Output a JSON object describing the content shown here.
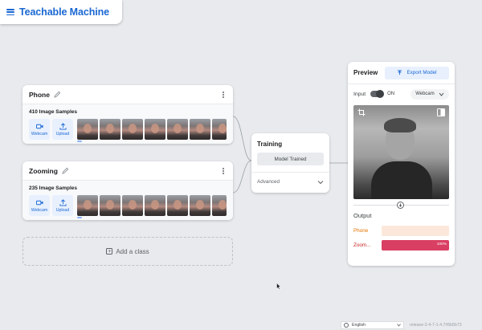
{
  "app": {
    "title": "Teachable Machine"
  },
  "classes": [
    {
      "name": "Phone",
      "samples": "410 Image Samples",
      "webcam_label": "Webcam",
      "upload_label": "Upload"
    },
    {
      "name": "Zooming",
      "samples": "235 Image Samples",
      "webcam_label": "Webcam",
      "upload_label": "Upload"
    }
  ],
  "add_class": {
    "label": "Add a class"
  },
  "training": {
    "title": "Training",
    "button_label": "Model Trained",
    "advanced_label": "Advanced"
  },
  "preview": {
    "title": "Preview",
    "export_label": "Export Model",
    "input_label": "Input",
    "toggle_state": "ON",
    "source_select": "Webcam",
    "output_title": "Output",
    "outputs": [
      {
        "label": "Phone",
        "confidence": 0,
        "percent_text": "",
        "label_color": "#e37400",
        "track_color": "#fce8db",
        "fill_color": "#f29d4b"
      },
      {
        "label": "Zoom...",
        "confidence": 1,
        "percent_text": "100%",
        "label_color": "#c5221f",
        "track_color": "#f8c9d2",
        "fill_color": "#d93f62"
      }
    ]
  },
  "footer": {
    "language": "English",
    "release": "release-2-4-7-1-4.7#5b5b73"
  },
  "colors": {
    "accent": "#1967d2",
    "background": "#e8eaed"
  }
}
